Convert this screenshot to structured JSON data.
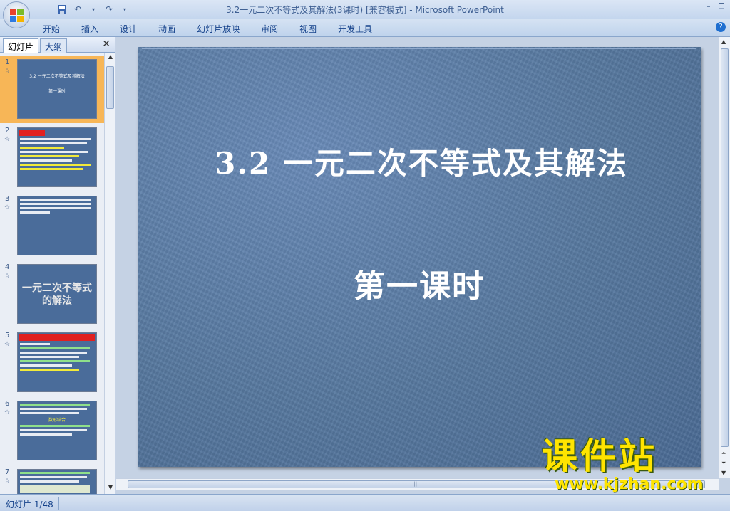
{
  "window": {
    "title": "3.2一元二次不等式及其解法(3课时) [兼容模式] - Microsoft PowerPoint",
    "minimize_icon": "minimize-icon",
    "maximize_icon": "maximize-icon"
  },
  "quick_access": {
    "save_icon": "save-icon",
    "undo_icon": "undo-icon",
    "redo_icon": "redo-icon",
    "customize_icon": "dropdown-icon"
  },
  "ribbon": {
    "tabs": [
      "开始",
      "插入",
      "设计",
      "动画",
      "幻灯片放映",
      "审阅",
      "视图",
      "开发工具"
    ],
    "help_label": "?"
  },
  "left_pane": {
    "tab_slides": "幻灯片",
    "tab_outline": "大纲",
    "close_label": "✕",
    "thumbnails": [
      {
        "num": "1",
        "title": "3.2  一元二次不等式及其解法",
        "subtitle": "第一课时"
      },
      {
        "num": "2"
      },
      {
        "num": "3"
      },
      {
        "num": "4",
        "big_text": "一元二次不等式的解法"
      },
      {
        "num": "5"
      },
      {
        "num": "6",
        "highlight": "数形结合"
      },
      {
        "num": "7"
      }
    ]
  },
  "slide": {
    "title": "3.2   一元二次不等式及其解法",
    "subtitle": "第一课时"
  },
  "watermark": {
    "cn": "课件站",
    "url": "www.kjzhan.com"
  },
  "status_bar": {
    "slide_info": "幻灯片 1/48"
  },
  "colors": {
    "slide_bg": "#57799f",
    "selected_thumb": "#f7b657",
    "watermark": "#ffe400"
  }
}
